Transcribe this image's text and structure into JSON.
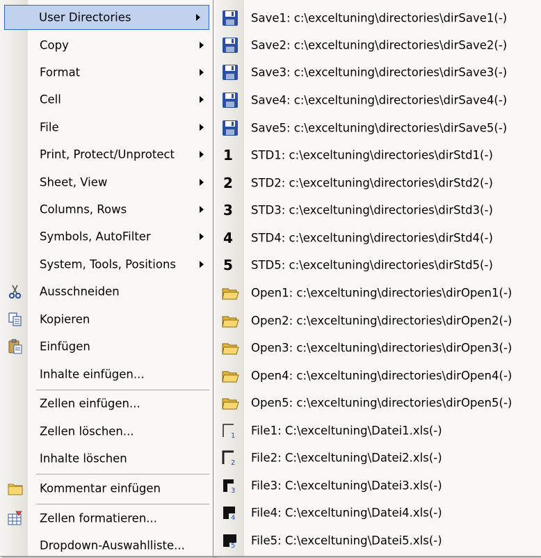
{
  "context_menu": {
    "items": [
      {
        "label": "User Directories",
        "submenu": true,
        "selected": true
      },
      {
        "label": "Copy",
        "submenu": true
      },
      {
        "label": "Format",
        "submenu": true
      },
      {
        "label": "Cell",
        "submenu": true
      },
      {
        "label": "File",
        "submenu": true
      },
      {
        "label": "Print, Protect/Unprotect",
        "submenu": true
      },
      {
        "label": "Sheet, View",
        "submenu": true
      },
      {
        "label": "Columns, Rows",
        "submenu": true
      },
      {
        "label": "Symbols, AutoFilter",
        "submenu": true
      },
      {
        "label": "System, Tools, Positions",
        "submenu": true
      },
      {
        "label": "Ausschneiden",
        "icon": "scissors-icon"
      },
      {
        "label": "Kopieren",
        "icon": "copy-icon"
      },
      {
        "label": "Einfügen",
        "icon": "paste-icon"
      },
      {
        "label": "Inhalte einfügen..."
      },
      {
        "label": "Zellen einfügen..."
      },
      {
        "label": "Zellen löschen..."
      },
      {
        "label": "Inhalte löschen"
      },
      {
        "label": "Kommentar einfügen",
        "icon": "comment-icon"
      },
      {
        "label": "Zellen formatieren...",
        "icon": "format-cells-icon"
      },
      {
        "label": "Dropdown-Auswahlliste..."
      }
    ]
  },
  "submenu": {
    "items": [
      {
        "label": "Save1: c:\\exceltuning\\directories\\dirSave1(-)",
        "icon": "save-icon"
      },
      {
        "label": "Save2: c:\\exceltuning\\directories\\dirSave2(-)",
        "icon": "save-icon"
      },
      {
        "label": "Save3: c:\\exceltuning\\directories\\dirSave3(-)",
        "icon": "save-icon"
      },
      {
        "label": "Save4: c:\\exceltuning\\directories\\dirSave4(-)",
        "icon": "save-icon"
      },
      {
        "label": "Save5: c:\\exceltuning\\directories\\dirSave5(-)",
        "icon": "save-icon"
      },
      {
        "label": "STD1: c:\\exceltuning\\directories\\dirStd1(-)",
        "icon": "number-1-icon",
        "glyph": "1"
      },
      {
        "label": "STD2: c:\\exceltuning\\directories\\dirStd2(-)",
        "icon": "number-2-icon",
        "glyph": "2"
      },
      {
        "label": "STD3: c:\\exceltuning\\directories\\dirStd3(-)",
        "icon": "number-3-icon",
        "glyph": "3"
      },
      {
        "label": "STD4: c:\\exceltuning\\directories\\dirStd4(-)",
        "icon": "number-4-icon",
        "glyph": "4"
      },
      {
        "label": "STD5: c:\\exceltuning\\directories\\dirStd5(-)",
        "icon": "number-5-icon",
        "glyph": "5"
      },
      {
        "label": "Open1: c:\\exceltuning\\directories\\dirOpen1(-)",
        "icon": "open-folder-icon"
      },
      {
        "label": "Open2: c:\\exceltuning\\directories\\dirOpen2(-)",
        "icon": "open-folder-icon"
      },
      {
        "label": "Open3: c:\\exceltuning\\directories\\dirOpen3(-)",
        "icon": "open-folder-icon"
      },
      {
        "label": "Open4: c:\\exceltuning\\directories\\dirOpen4(-)",
        "icon": "open-folder-icon"
      },
      {
        "label": "Open5: c:\\exceltuning\\directories\\dirOpen5(-)",
        "icon": "open-folder-icon"
      },
      {
        "label": "File1: C:\\exceltuning\\Datei1.xls(-)",
        "icon": "file-1-icon",
        "glyph": "1"
      },
      {
        "label": "File2: C:\\exceltuning\\Datei2.xls(-)",
        "icon": "file-2-icon",
        "glyph": "2"
      },
      {
        "label": "File3: C:\\exceltuning\\Datei3.xls(-)",
        "icon": "file-3-icon",
        "glyph": "3"
      },
      {
        "label": "File4: C:\\exceltuning\\Datei4.xls(-)",
        "icon": "file-4-icon",
        "glyph": "4"
      },
      {
        "label": "File5: C:\\exceltuning\\Datei5.xls(-)",
        "icon": "file-5-icon",
        "glyph": "5"
      }
    ]
  },
  "colors": {
    "selection_fill": "#c1d2ee",
    "selection_border": "#316ac5",
    "menu_bg": "#f9f8f6",
    "save_blue": "#2a4fa3",
    "folder_yellow": "#f2c94c"
  }
}
